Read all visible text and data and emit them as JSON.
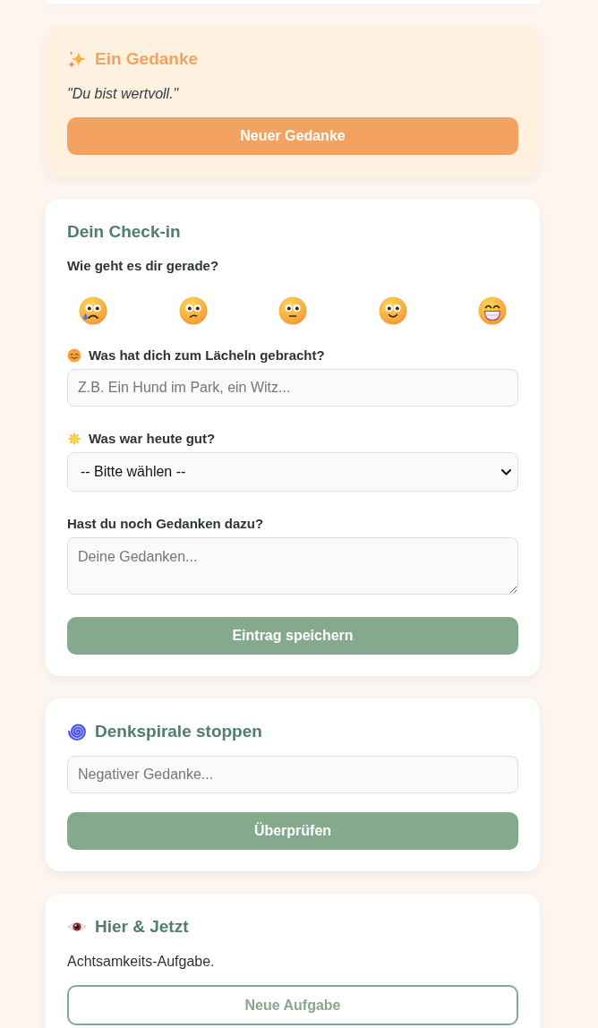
{
  "thought_card": {
    "title": "Ein Gedanke",
    "quote": "\"Du bist wertvoll.\"",
    "button": "Neuer Gedanke"
  },
  "checkin": {
    "title": "Dein Check-in",
    "mood_question": "Wie geht es dir gerade?",
    "moods": [
      {
        "kind": "crying",
        "selected": false
      },
      {
        "kind": "worried",
        "selected": false
      },
      {
        "kind": "neutral",
        "selected": false
      },
      {
        "kind": "smiling",
        "selected": false
      },
      {
        "kind": "grinning",
        "selected": false
      }
    ],
    "smile_field": {
      "label": "Was hat dich zum Lächeln gebracht?",
      "placeholder": "Z.B. Ein Hund im Park, ein Witz..."
    },
    "good_field": {
      "label": "Was war heute gut?",
      "value": "-- Bitte wählen --"
    },
    "notes_field": {
      "label": "Hast du noch Gedanken dazu?",
      "placeholder": "Deine Gedanken..."
    },
    "button": "Eintrag speichern"
  },
  "spiral_card": {
    "title": "Denkspirale stoppen",
    "placeholder": "Negativer Gedanke...",
    "button": "Überprüfen"
  },
  "mindfulness_card": {
    "title": "Hier & Jetzt",
    "task": "Achtsamkeits-Aufgabe.",
    "button": "Neue Aufgabe"
  }
}
